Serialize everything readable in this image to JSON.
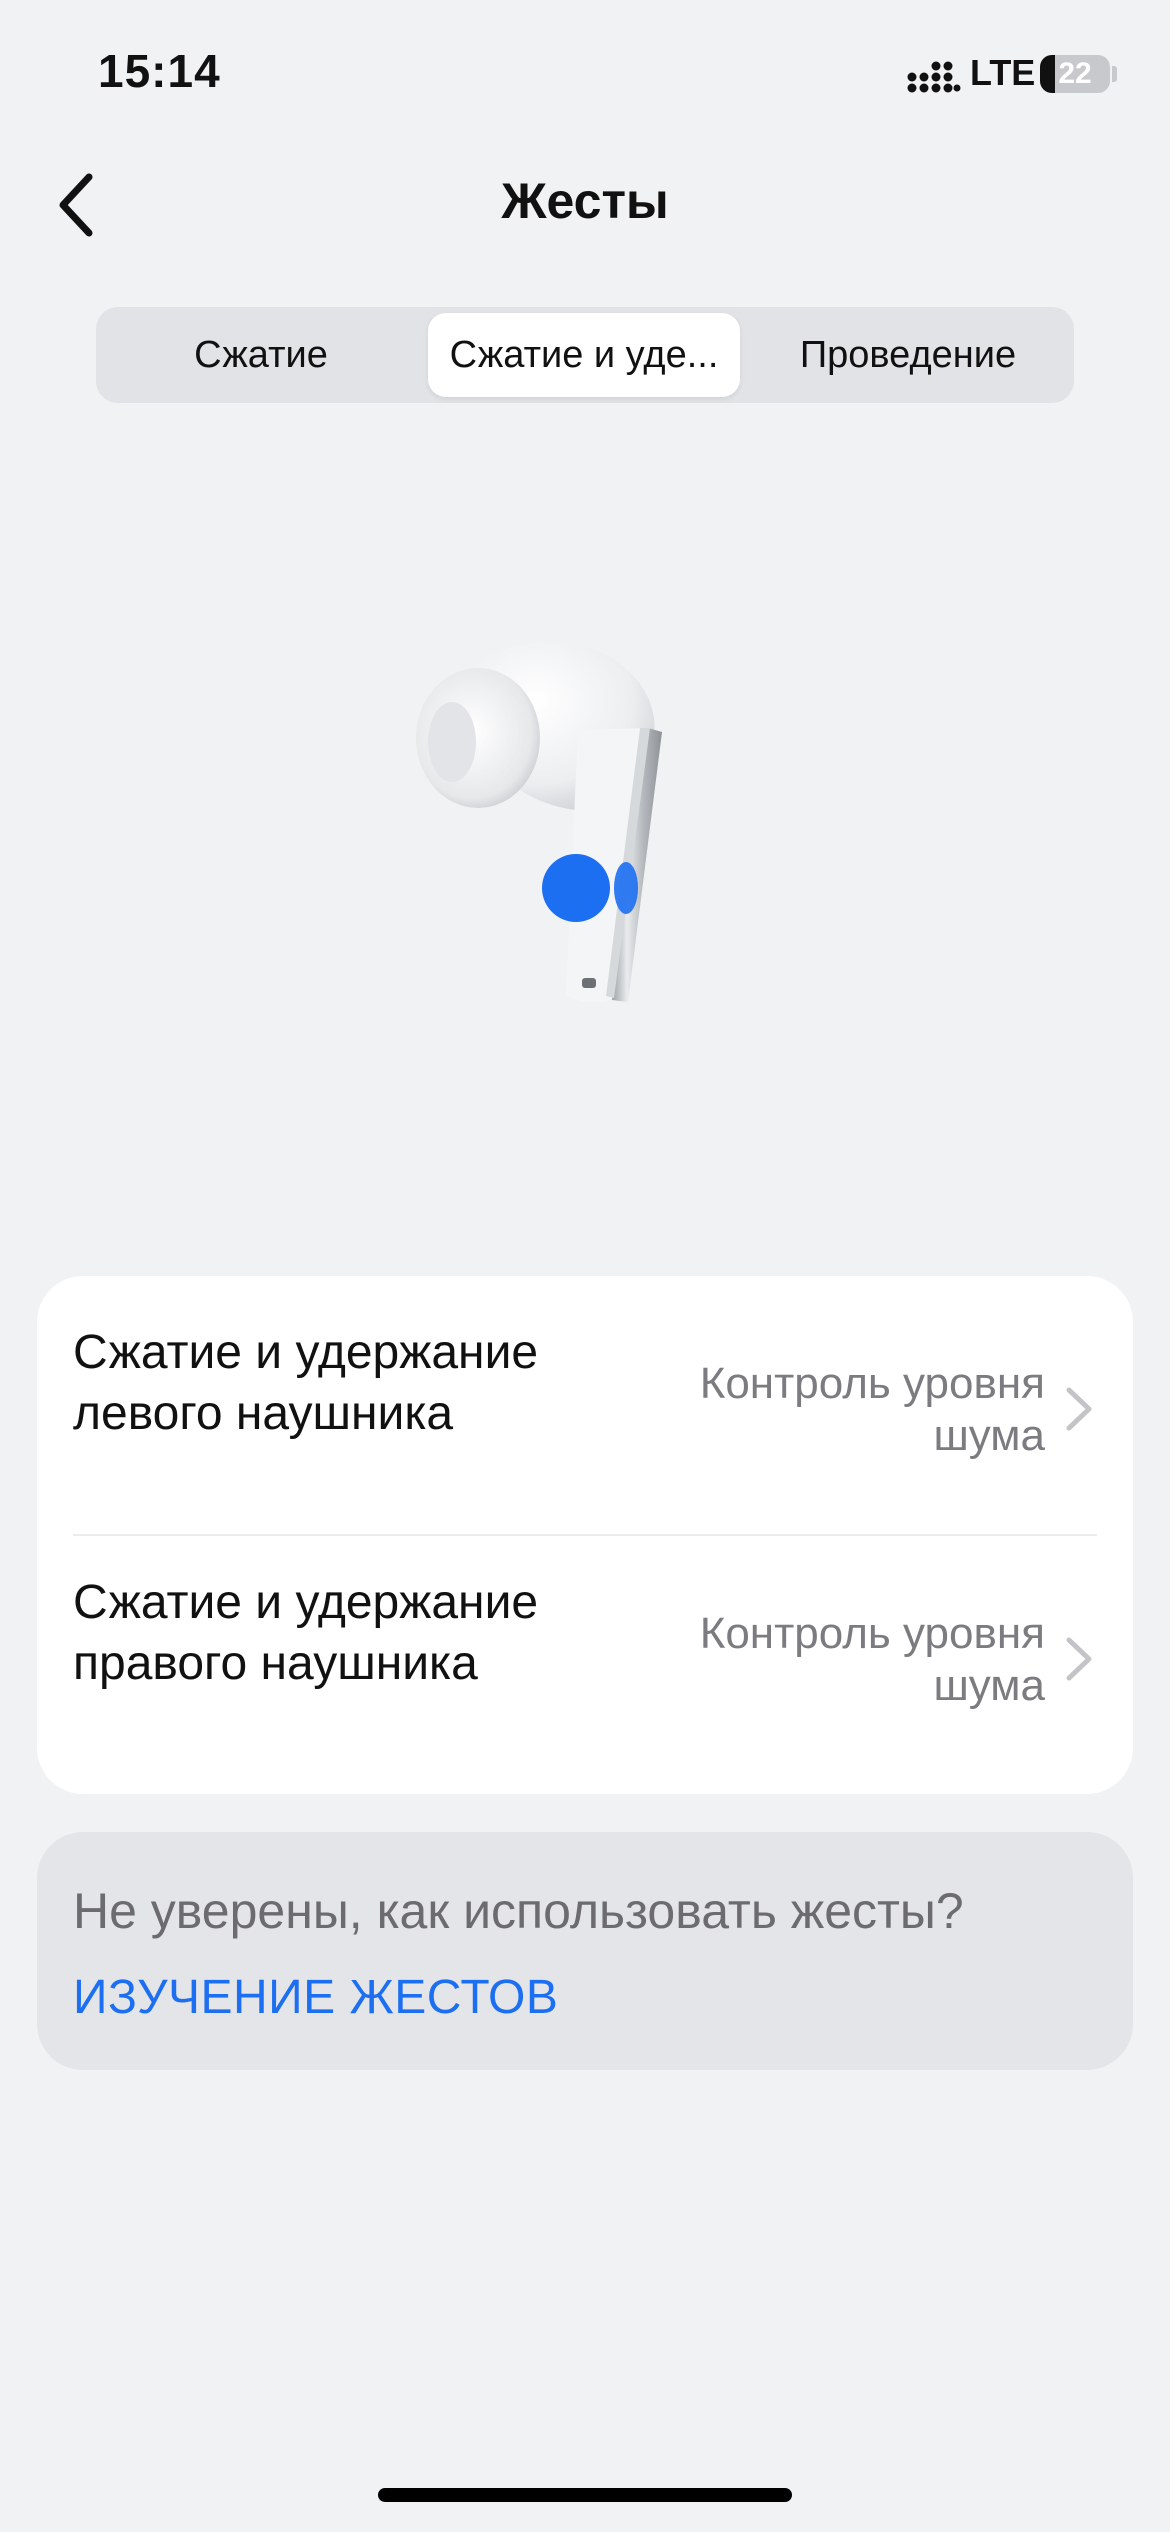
{
  "status_bar": {
    "time": "15:14",
    "network": "LTE",
    "battery_level": "22"
  },
  "nav": {
    "title": "Жесты",
    "back_icon": "chevron-left-icon"
  },
  "tabs": [
    {
      "label": "Сжатие",
      "active": false
    },
    {
      "label": "Сжатие и уде...",
      "active": true
    },
    {
      "label": "Проведение",
      "active": false
    }
  ],
  "illustration": {
    "icon": "earbud-illustration",
    "accent_color": "#1d6ff2"
  },
  "settings": {
    "rows": [
      {
        "label": "Сжатие и удержание левого наушника",
        "value": "Контроль уровня шума"
      },
      {
        "label": "Сжатие и удержание правого наушника",
        "value": "Контроль уровня шума"
      }
    ]
  },
  "help": {
    "question": "Не уверены, как использовать жесты?",
    "link": "ИЗУЧЕНИЕ ЖЕСТОВ"
  },
  "colors": {
    "background": "#f1f2f4",
    "accent": "#1d6ff2",
    "secondary_text": "#7b7b80"
  }
}
